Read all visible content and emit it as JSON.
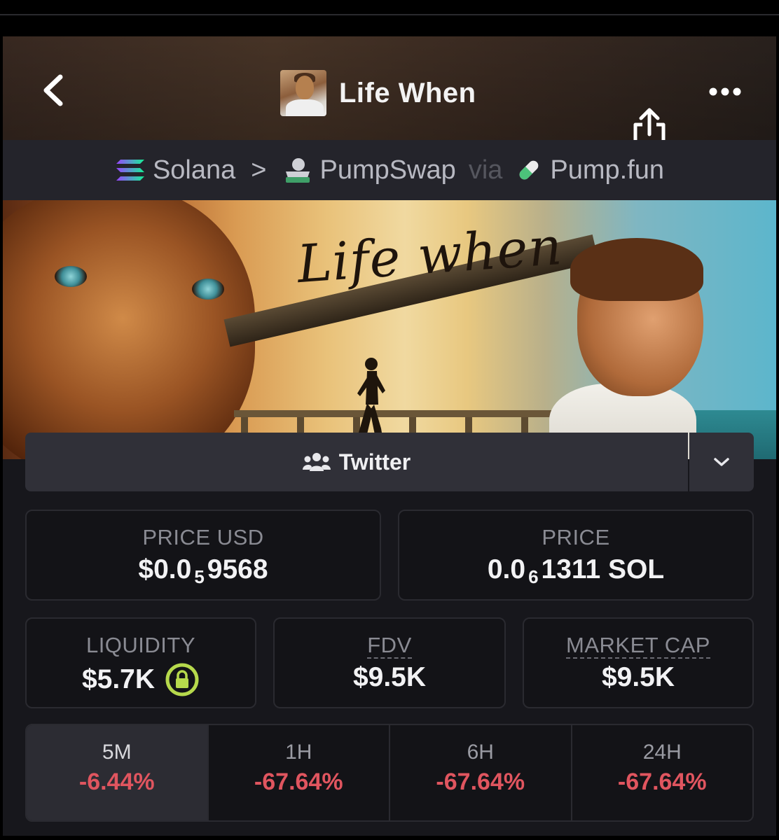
{
  "header": {
    "title": "Life When",
    "back_icon": "chevron-left-icon",
    "share_icon": "share-icon",
    "more_icon": "more-horizontal-icon"
  },
  "breadcrumb": {
    "chain": "Solana",
    "separator": ">",
    "dex": "PumpSwap",
    "via": "via",
    "launchpad": "Pump.fun"
  },
  "banner": {
    "title": "Life when"
  },
  "socials": {
    "twitter_label": "Twitter"
  },
  "stats": {
    "price_usd": {
      "label": "PRICE USD",
      "prefix": "$0.0",
      "zeros": "5",
      "digits": "9568"
    },
    "price_native": {
      "label": "PRICE",
      "prefix": "0.0",
      "zeros": "6",
      "digits": "1311 SOL"
    },
    "liquidity": {
      "label": "LIQUIDITY",
      "value": "$5.7K"
    },
    "fdv": {
      "label": "FDV",
      "value": "$9.5K"
    },
    "market_cap": {
      "label": "MARKET CAP",
      "value": "$9.5K"
    }
  },
  "timeframes": [
    {
      "label": "5M",
      "change": "-6.44%",
      "active": true
    },
    {
      "label": "1H",
      "change": "-67.64%",
      "active": false
    },
    {
      "label": "6H",
      "change": "-67.64%",
      "active": false
    },
    {
      "label": "24H",
      "change": "-67.64%",
      "active": false
    }
  ],
  "colors": {
    "negative": "#e0555f",
    "lock_green": "#b6d94c",
    "solana_gradient_start": "#9945ff",
    "solana_gradient_end": "#14f195"
  }
}
